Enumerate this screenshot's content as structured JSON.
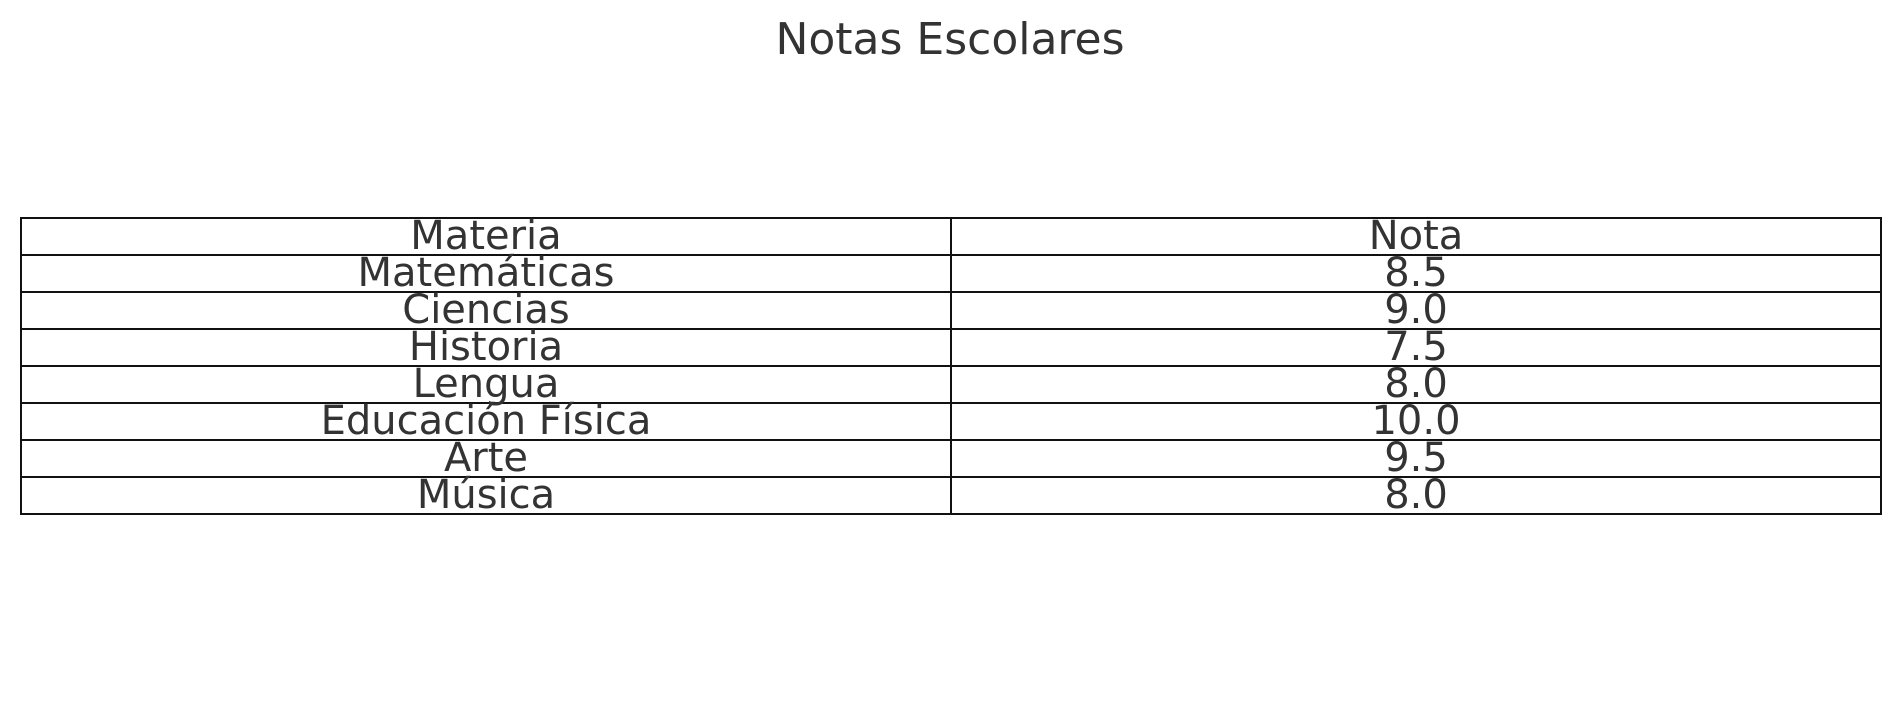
{
  "chart_data": {
    "type": "table",
    "title": "Notas Escolares",
    "columns": [
      "Materia",
      "Nota"
    ],
    "rows": [
      [
        "Matemáticas",
        "8.5"
      ],
      [
        "Ciencias",
        "9.0"
      ],
      [
        "Historia",
        "7.5"
      ],
      [
        "Lengua",
        "8.0"
      ],
      [
        "Educación Física",
        "10.0"
      ],
      [
        "Arte",
        "9.5"
      ],
      [
        "Música",
        "8.0"
      ]
    ]
  }
}
